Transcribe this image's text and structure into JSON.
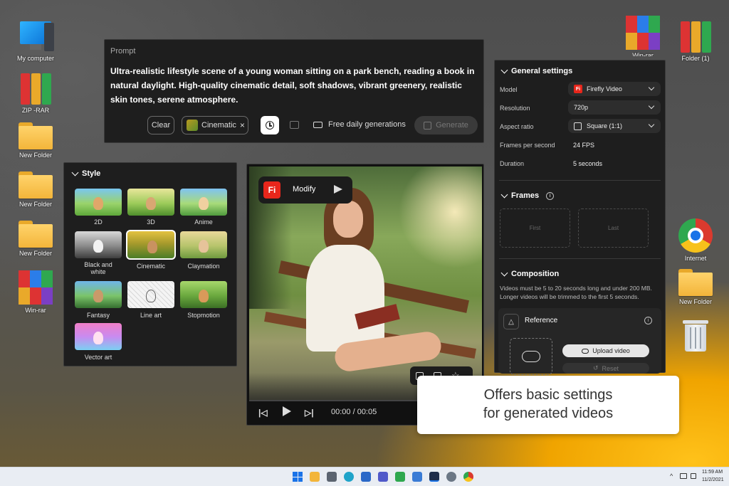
{
  "desktop_left": [
    {
      "label": "My computer",
      "icon": "computer-icon"
    },
    {
      "label": "ZIP -RAR",
      "icon": "binders-icon"
    },
    {
      "label": "New Folder",
      "icon": "folder-icon"
    },
    {
      "label": "New Folder",
      "icon": "folder-icon"
    },
    {
      "label": "New Folder",
      "icon": "folder-icon"
    },
    {
      "label": "Win-rar",
      "icon": "winrar-icon"
    }
  ],
  "desktop_right": [
    {
      "label": "Win-rar",
      "icon": "winrar-icon"
    },
    {
      "label": "Folder (1)",
      "icon": "binders-icon"
    },
    {
      "label": "Internet",
      "icon": "chrome-icon"
    },
    {
      "label": "New Folder",
      "icon": "folder-icon"
    },
    {
      "label": "",
      "icon": "recycle-bin-icon"
    }
  ],
  "prompt": {
    "label": "Prompt",
    "text": "Ultra-realistic lifestyle scene of a young woman sitting on a park bench, reading a book in natural daylight. High-quality cinematic detail, soft shadows, vibrant greenery, realistic skin tones, serene atmosphere.",
    "clear": "Clear",
    "style_chip": "Cinematic",
    "chip_close": "×",
    "free_generations": "Free daily generations",
    "generate": "Generate"
  },
  "style": {
    "title": "Style",
    "options": [
      {
        "label": "2D"
      },
      {
        "label": "3D"
      },
      {
        "label": "Anime"
      },
      {
        "label": "Black and white"
      },
      {
        "label": "Cinematic",
        "selected": true
      },
      {
        "label": "Claymation"
      },
      {
        "label": "Fantasy"
      },
      {
        "label": "Line art"
      },
      {
        "label": "Stopmotion"
      },
      {
        "label": "Vector art"
      }
    ]
  },
  "video": {
    "app_badge": "Fi",
    "modify": "Modify",
    "time": "00:00 / 00:05",
    "progress": 0
  },
  "settings": {
    "general_title": "General settings",
    "model_label": "Model",
    "model_value": "Firefly Video",
    "model_badge": "Fi",
    "resolution_label": "Resolution",
    "resolution_value": "720p",
    "aspect_label": "Aspect ratio",
    "aspect_value": "Square (1:1)",
    "fps_label": "Frames per second",
    "fps_value": "24 FPS",
    "duration_label": "Duration",
    "duration_value": "5 seconds",
    "frames_title": "Frames",
    "first": "First",
    "last": "Last",
    "composition_title": "Composition",
    "composition_note": "Videos must be 5 to 20 seconds long and under 200 MB. Longer videos will be trimmed to the first 5 seconds.",
    "reference_title": "Reference",
    "upload": "Upload video",
    "reset": "Reset"
  },
  "caption": {
    "line1": "Offers basic settings",
    "line2": "for generated videos"
  },
  "taskbar": {
    "time": "11:59 AM",
    "date": "11/2/2021"
  }
}
